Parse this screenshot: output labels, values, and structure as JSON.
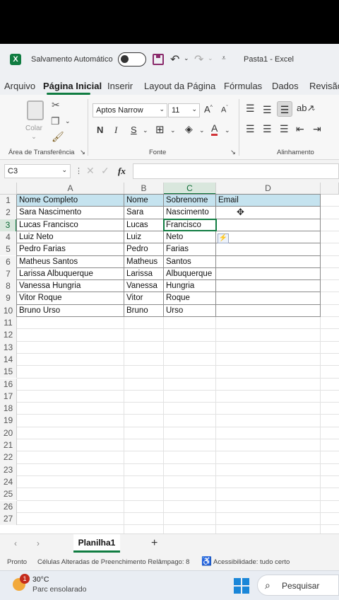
{
  "titlebar": {
    "autosave_label": "Salvamento Automático",
    "title": "Pasta1  -  Excel"
  },
  "ribbon_tabs": [
    "Arquivo",
    "Página Inicial",
    "Inserir",
    "Layout da Página",
    "Fórmulas",
    "Dados",
    "Revisão"
  ],
  "ribbon": {
    "paste_label": "Colar",
    "font_name": "Aptos Narrow",
    "font_size": "11",
    "group_clipboard": "Área de Transferência",
    "group_font": "Fonte",
    "group_alignment": "Alinhamento"
  },
  "formula_bar": {
    "name_box": "C3",
    "fx": "fx",
    "value": ""
  },
  "columns": [
    "A",
    "B",
    "C",
    "D"
  ],
  "selected_cell": "C3",
  "rows": [
    {
      "n": "1",
      "a": "Nome Completo",
      "b": "Nome",
      "c": "Sobrenome",
      "d": "Email"
    },
    {
      "n": "2",
      "a": "Sara Nascimento",
      "b": "Sara",
      "c": "Nascimento",
      "d": ""
    },
    {
      "n": "3",
      "a": "Lucas Francisco",
      "b": "Lucas",
      "c": "Francisco",
      "d": ""
    },
    {
      "n": "4",
      "a": "Luiz Neto",
      "b": "Luiz",
      "c": "Neto",
      "d": ""
    },
    {
      "n": "5",
      "a": "Pedro Farias",
      "b": "Pedro",
      "c": "Farias",
      "d": ""
    },
    {
      "n": "6",
      "a": "Matheus Santos",
      "b": "Matheus",
      "c": "Santos",
      "d": ""
    },
    {
      "n": "7",
      "a": "Larissa Albuquerque",
      "b": "Larissa",
      "c": "Albuquerque",
      "d": ""
    },
    {
      "n": "8",
      "a": "Vanessa Hungria",
      "b": "Vanessa",
      "c": "Hungria",
      "d": ""
    },
    {
      "n": "9",
      "a": "Vitor Roque",
      "b": "Vitor",
      "c": "Roque",
      "d": ""
    },
    {
      "n": "10",
      "a": "Bruno Urso",
      "b": "Bruno",
      "c": "Urso",
      "d": ""
    },
    {
      "n": "11"
    },
    {
      "n": "12"
    },
    {
      "n": "13"
    },
    {
      "n": "14"
    },
    {
      "n": "15"
    },
    {
      "n": "16"
    },
    {
      "n": "17"
    },
    {
      "n": "18"
    },
    {
      "n": "19"
    },
    {
      "n": "20"
    },
    {
      "n": "21"
    },
    {
      "n": "22"
    },
    {
      "n": "23"
    },
    {
      "n": "24"
    },
    {
      "n": "25"
    },
    {
      "n": "26"
    },
    {
      "n": "27"
    }
  ],
  "sheet_tab": "Planilha1",
  "add_sheet": "+",
  "status": {
    "ready": "Pronto",
    "flash_fill": "Células Alteradas de Preenchimento Relâmpago: 8",
    "accessibility": "Acessibilidade: tudo certo"
  },
  "taskbar": {
    "weather_badge": "1",
    "temperature": "30°C",
    "condition": "Parc ensolarado",
    "search": "Pesquisar"
  },
  "colors": {
    "excel_green": "#107c41",
    "header_fill": "#c5e3ef",
    "font_red": "#d13438"
  }
}
